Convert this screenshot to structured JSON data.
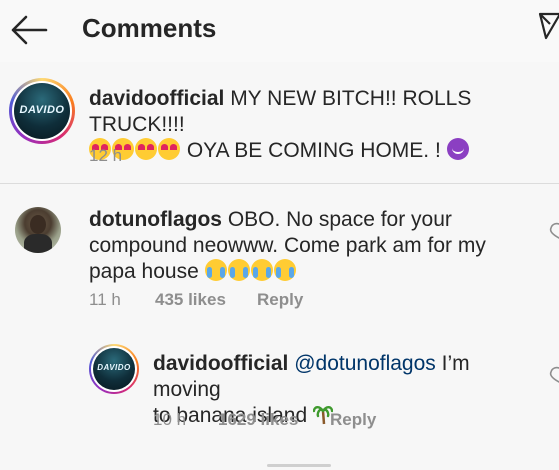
{
  "header": {
    "title": "Comments",
    "back_icon": "arrow-left-icon",
    "send_icon": "paper-plane-icon"
  },
  "caption": {
    "username": "davidoofficial",
    "text_line1": " MY NEW BITCH!! ROLLS TRUCK!!!!",
    "text_line2": " OYA BE COMING HOME. ! ",
    "time": "12 h",
    "avatar_label": "DAVIDO"
  },
  "comments": [
    {
      "username": "dotunoflagos",
      "text_line1": " OBO. No space for your",
      "text_line2": "compound neowww. Come park am for my",
      "text_line3": "papa house ",
      "time": "11 h",
      "likes": "435 likes",
      "reply": "Reply"
    }
  ],
  "replies": [
    {
      "username": "davidoofficial",
      "mention": "@dotunoflagos",
      "text_line1": " I’m moving",
      "text_line2": "to banana island ",
      "time": "10 h",
      "likes": "1629 likes",
      "reply": "Reply",
      "avatar_label": "DAVIDO"
    }
  ],
  "colors": {
    "text": "#262626",
    "meta": "#8e8e8e",
    "mention": "#003569"
  }
}
